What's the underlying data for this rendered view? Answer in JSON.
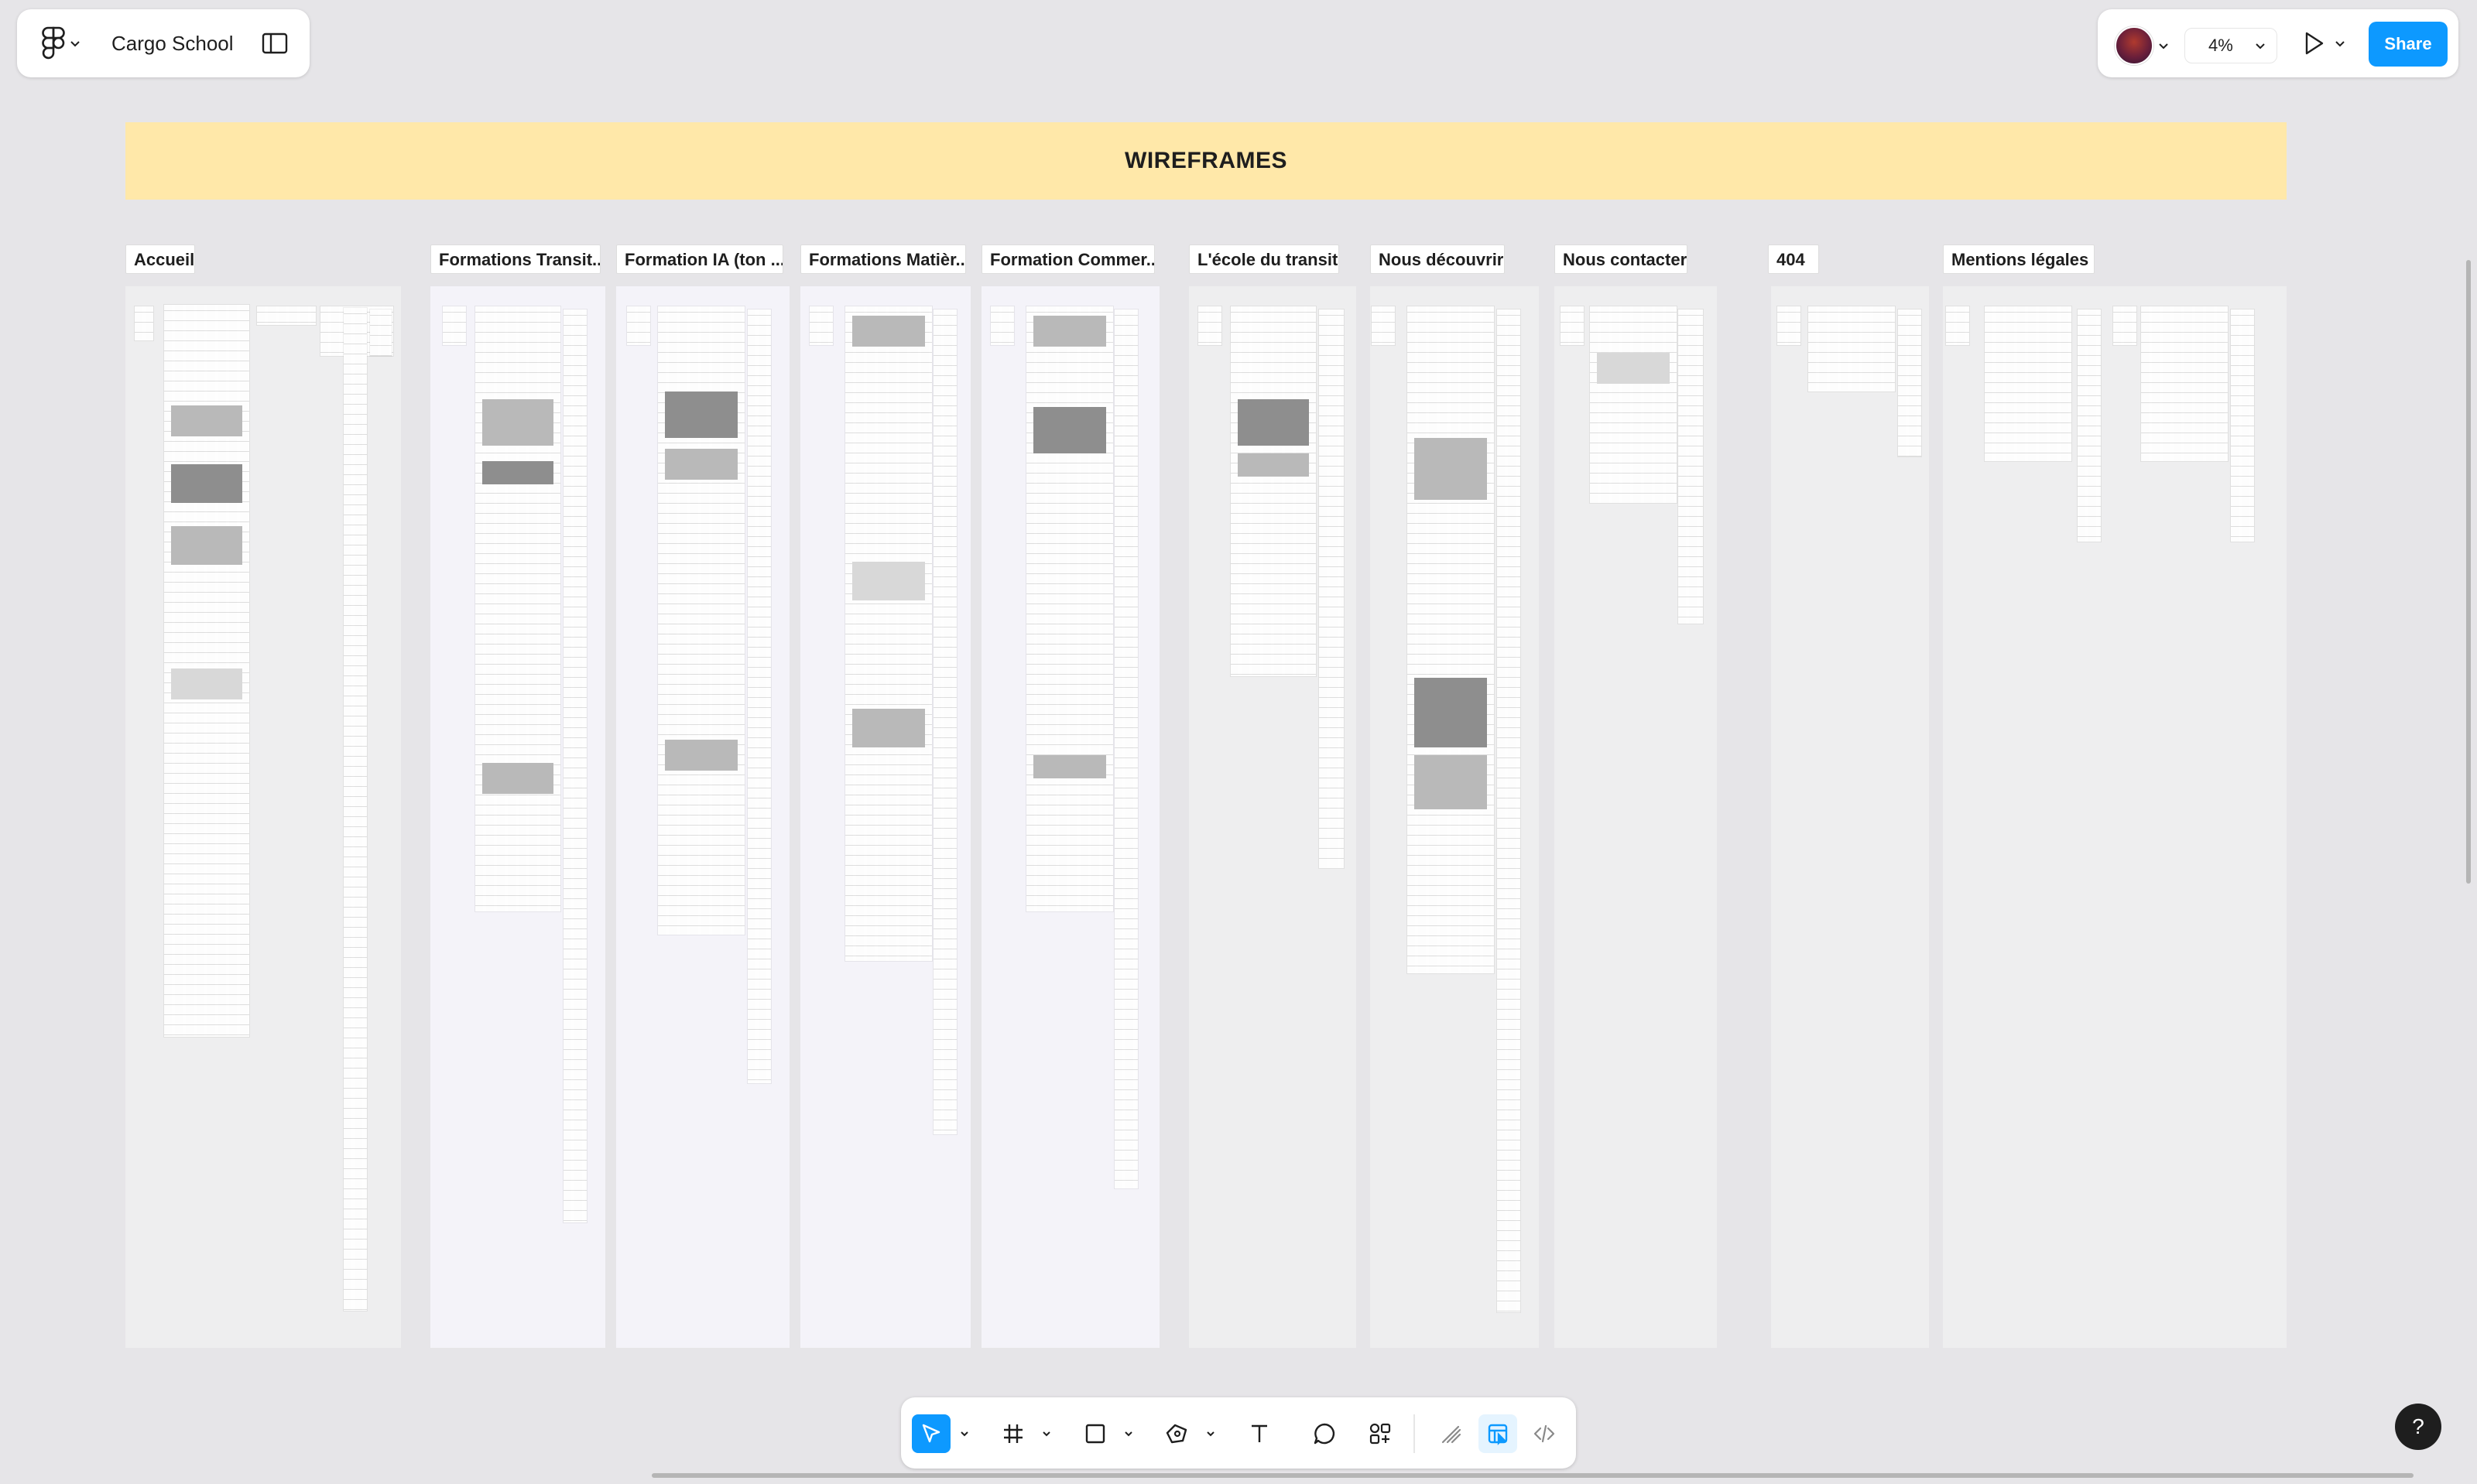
{
  "file": {
    "name": "Cargo School"
  },
  "header": {
    "zoom": "4%",
    "share_label": "Share"
  },
  "banner": {
    "title": "WIREFRAMES"
  },
  "sections": [
    {
      "label": "Accueil"
    },
    {
      "label": "Formations Transit..."
    },
    {
      "label": "Formation IA (ton ..."
    },
    {
      "label": "Formations Matièr..."
    },
    {
      "label": "Formation Commer..."
    },
    {
      "label": "L'école du transit"
    },
    {
      "label": "Nous découvrir"
    },
    {
      "label": "Nous contacter"
    },
    {
      "label": "404"
    },
    {
      "label": "Mentions légales"
    }
  ],
  "toolbar": {
    "tools": [
      "move-tool",
      "frame-tool",
      "shape-tool",
      "pen-tool",
      "text-tool",
      "comment-tool",
      "actions-tool"
    ],
    "active_tool": "move-tool",
    "modes": [
      "draw-mode",
      "design-mode",
      "dev-mode"
    ],
    "active_mode": "design-mode"
  },
  "help": {
    "label": "?"
  },
  "colors": {
    "accent": "#0d99ff",
    "banner": "#ffe8a9",
    "canvas": "#e6e5e8"
  }
}
